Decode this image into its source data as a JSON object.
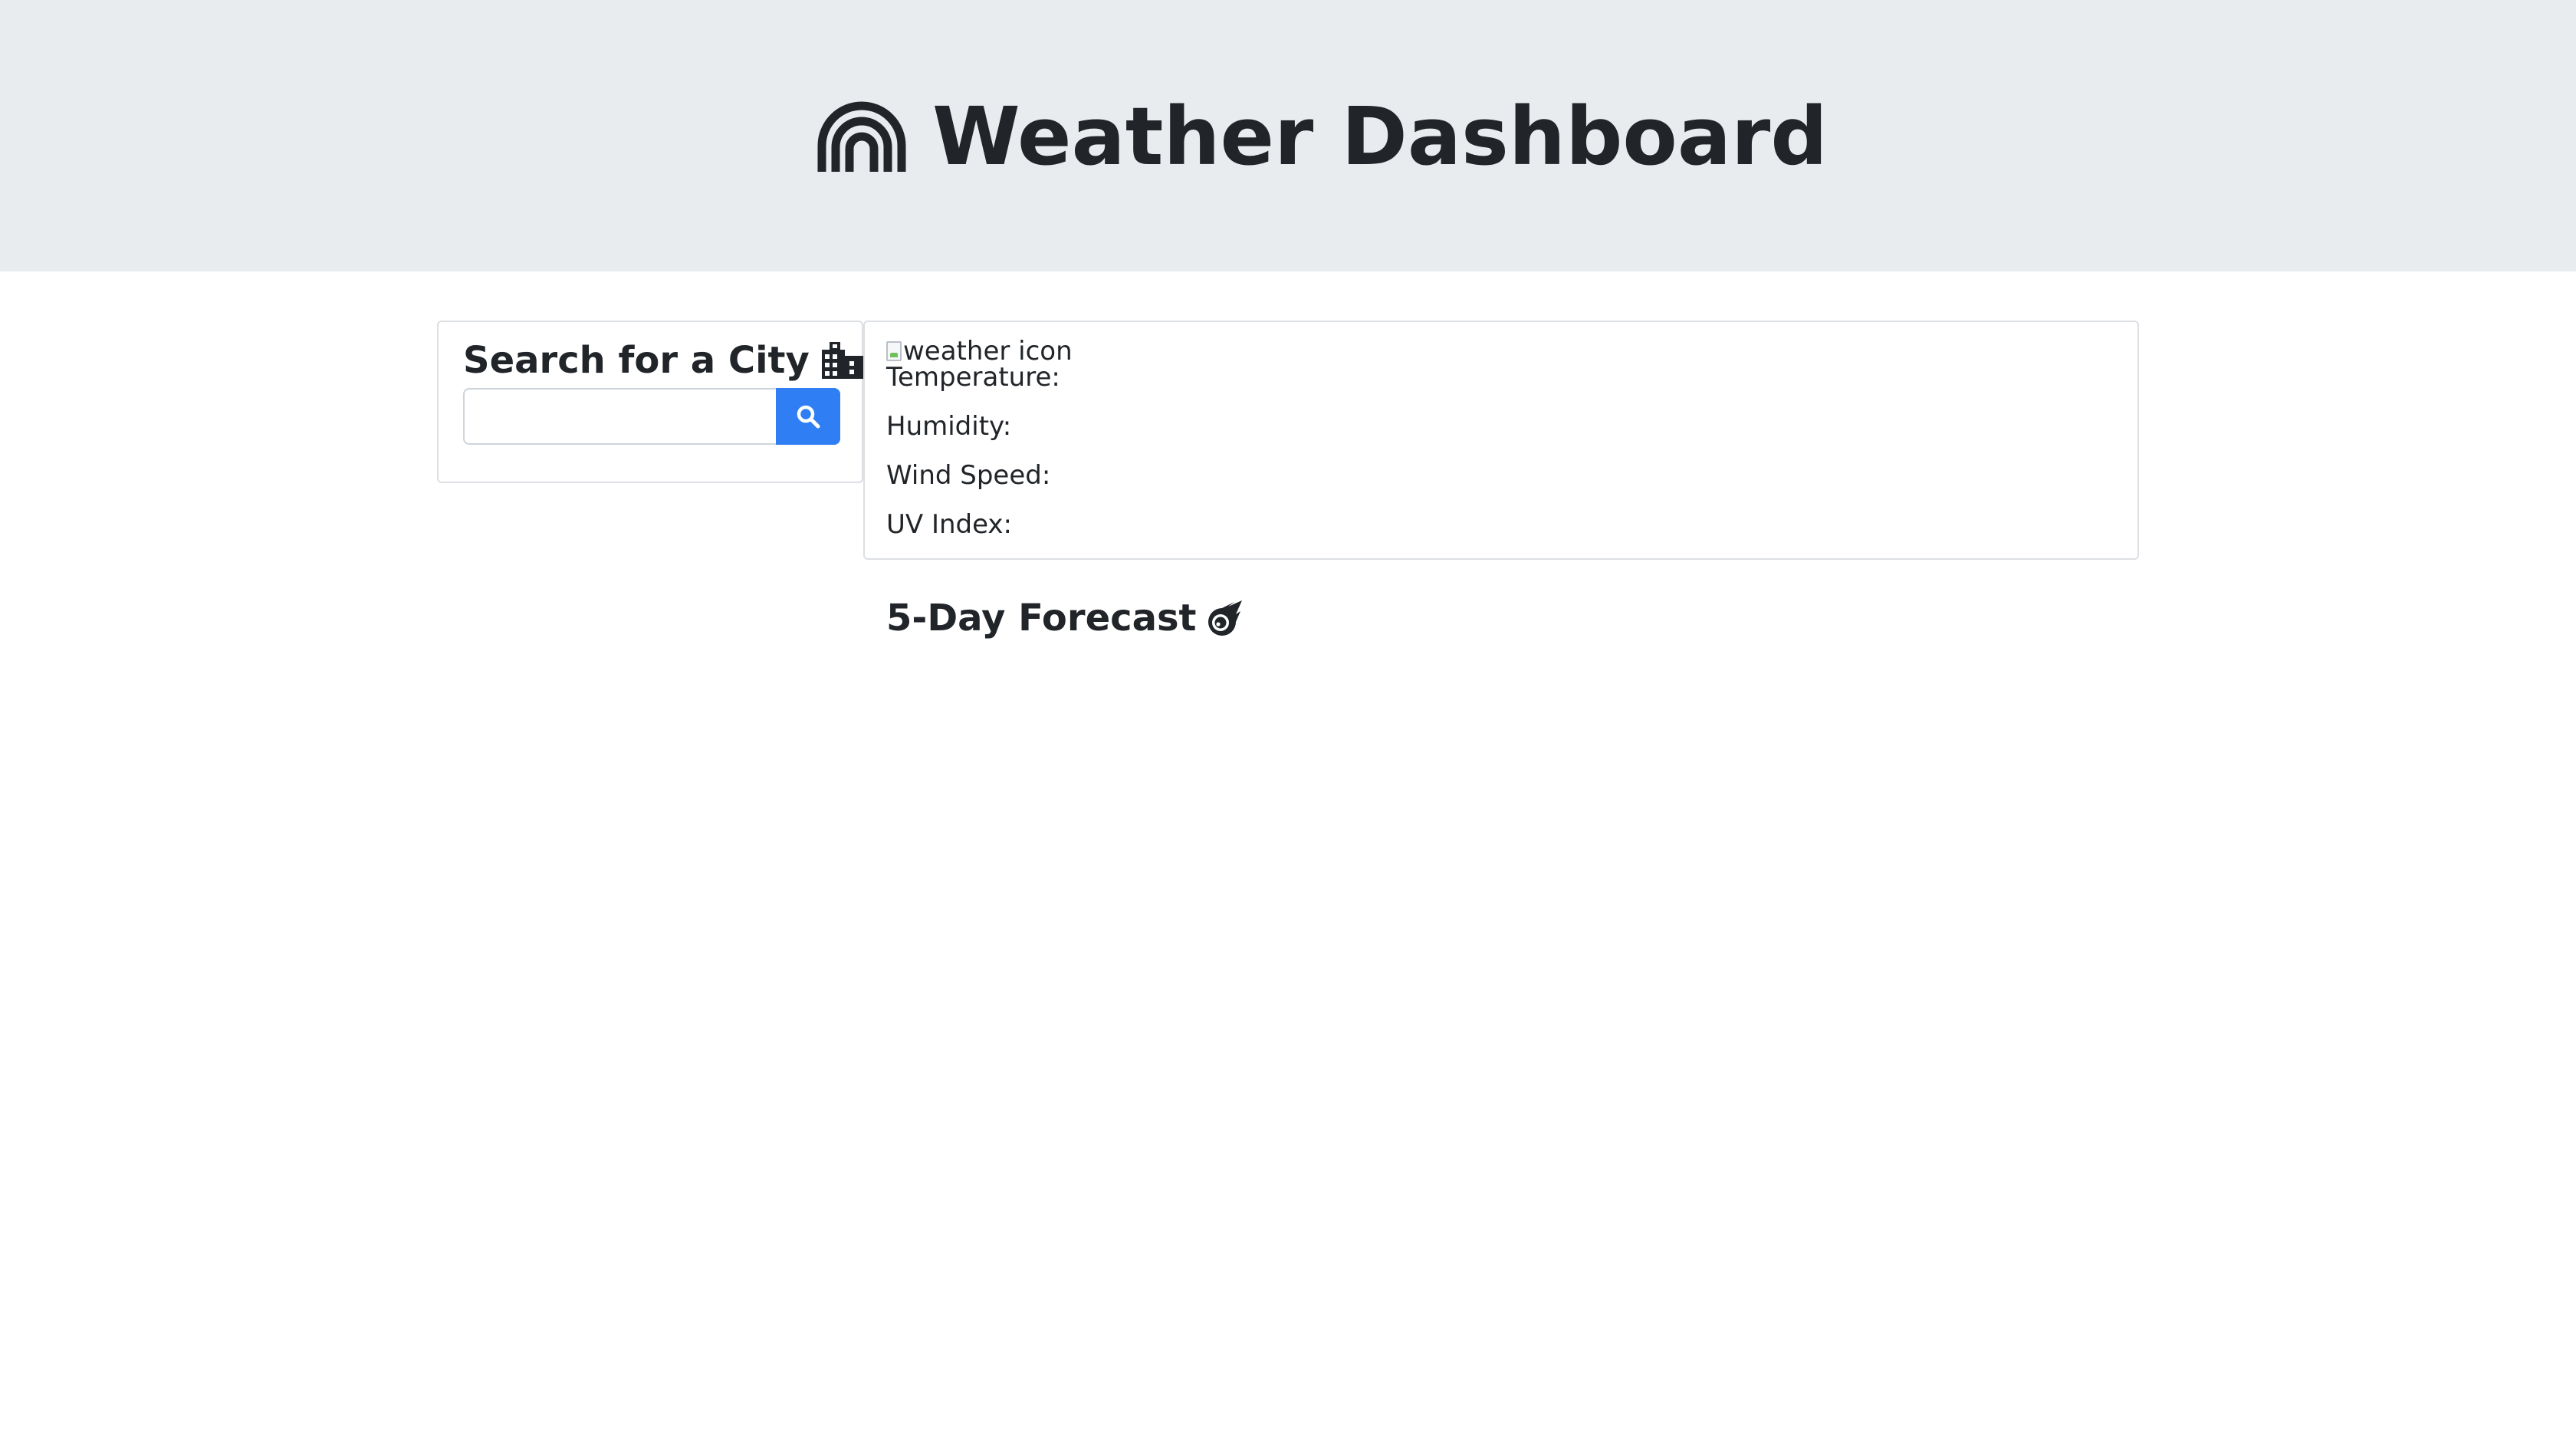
{
  "header": {
    "title": "Weather Dashboard",
    "icon": "rainbow-icon",
    "background": "#e9ecef"
  },
  "search": {
    "title": "Search for a City",
    "title_icon": "city-icon",
    "input_value": "",
    "input_placeholder": "",
    "button_icon": "search-icon",
    "button_color": "#2f7ef4"
  },
  "current": {
    "weather_icon_alt": "weather icon",
    "temperature_label": "Temperature:",
    "humidity_label": "Humidity:",
    "wind_label": "Wind Speed:",
    "uv_label": "UV Index:"
  },
  "forecast": {
    "title": "5-Day Forecast",
    "title_icon": "meteor-icon"
  }
}
